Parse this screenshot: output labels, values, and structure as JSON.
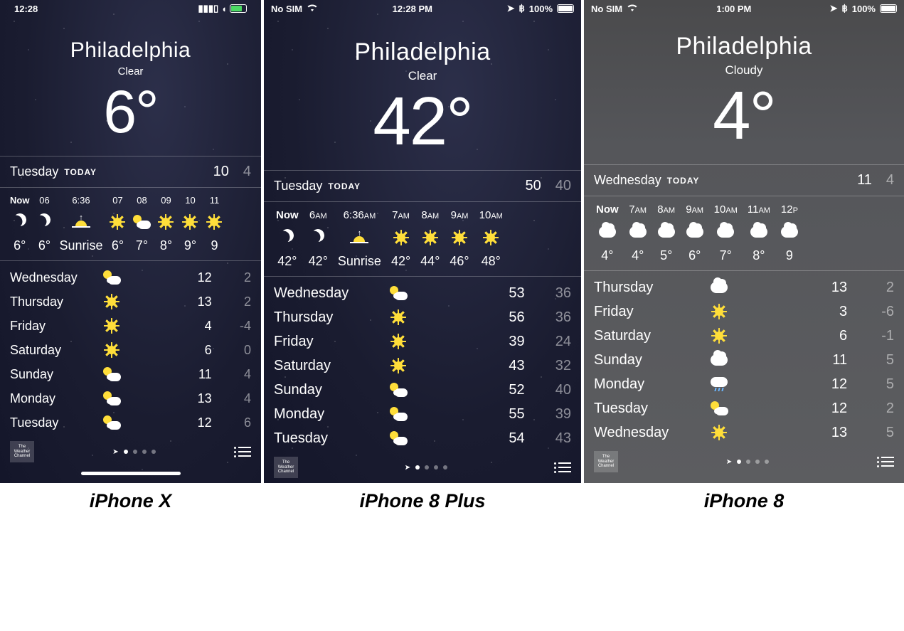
{
  "captions": [
    "iPhone X",
    "iPhone 8 Plus",
    "iPhone 8"
  ],
  "phones": [
    {
      "style": "starry notch",
      "status": {
        "left": "12:28",
        "carrier": "",
        "right_items": [],
        "battery": "",
        "has_wifi": true,
        "has_cell": true,
        "charging": true
      },
      "city": "Philadelphia",
      "condition": "Clear",
      "temp": "6°",
      "today": {
        "day": "Tuesday",
        "label": "TODAY",
        "hi": "10",
        "lo": "4"
      },
      "hours": [
        {
          "t": "Now",
          "icon": "moon",
          "v": "6°",
          "now": true
        },
        {
          "t": "06",
          "icon": "moon",
          "v": "6°"
        },
        {
          "t": "6:36",
          "icon": "sunrise",
          "v": "Sunrise"
        },
        {
          "t": "07",
          "icon": "sun",
          "v": "6°"
        },
        {
          "t": "08",
          "icon": "partly",
          "v": "7°"
        },
        {
          "t": "09",
          "icon": "sun",
          "v": "8°"
        },
        {
          "t": "10",
          "icon": "sun",
          "v": "9°"
        },
        {
          "t": "11",
          "icon": "sun",
          "v": "9"
        }
      ],
      "days": [
        {
          "n": "Wednesday",
          "i": "partly",
          "h": "12",
          "l": "2"
        },
        {
          "n": "Thursday",
          "i": "sun",
          "h": "13",
          "l": "2"
        },
        {
          "n": "Friday",
          "i": "sun",
          "h": "4",
          "l": "-4"
        },
        {
          "n": "Saturday",
          "i": "sun",
          "h": "6",
          "l": "0"
        },
        {
          "n": "Sunday",
          "i": "partly",
          "h": "11",
          "l": "4"
        },
        {
          "n": "Monday",
          "i": "partly",
          "h": "13",
          "l": "4"
        },
        {
          "n": "Tuesday",
          "i": "partly",
          "h": "12",
          "l": "6"
        }
      ],
      "pager_dots": 4,
      "twc": "The\nWeather\nChannel",
      "homebar": true
    },
    {
      "style": "starry",
      "status": {
        "left": "",
        "carrier": "No SIM",
        "time": "12:28 PM",
        "right": "100%",
        "has_wifi": true,
        "has_loc": true,
        "has_bt": true,
        "has_batt": true
      },
      "city": "Philadelphia",
      "condition": "Clear",
      "temp": "42°",
      "today": {
        "day": "Tuesday",
        "label": "TODAY",
        "hi": "50",
        "lo": "40"
      },
      "hours": [
        {
          "t": "Now",
          "icon": "moon",
          "v": "42°",
          "now": true
        },
        {
          "t": "6",
          "ampm": "AM",
          "icon": "moon",
          "v": "42°"
        },
        {
          "t": "6:36",
          "ampm": "AM",
          "icon": "sunrise",
          "v": "Sunrise"
        },
        {
          "t": "7",
          "ampm": "AM",
          "icon": "sun",
          "v": "42°"
        },
        {
          "t": "8",
          "ampm": "AM",
          "icon": "sun",
          "v": "44°"
        },
        {
          "t": "9",
          "ampm": "AM",
          "icon": "sun",
          "v": "46°"
        },
        {
          "t": "10",
          "ampm": "AM",
          "icon": "sun",
          "v": "48°"
        }
      ],
      "days": [
        {
          "n": "Wednesday",
          "i": "partly",
          "h": "53",
          "l": "36"
        },
        {
          "n": "Thursday",
          "i": "sun",
          "h": "56",
          "l": "36"
        },
        {
          "n": "Friday",
          "i": "sun",
          "h": "39",
          "l": "24"
        },
        {
          "n": "Saturday",
          "i": "sun",
          "h": "43",
          "l": "32"
        },
        {
          "n": "Sunday",
          "i": "partly",
          "h": "52",
          "l": "40"
        },
        {
          "n": "Monday",
          "i": "partly",
          "h": "55",
          "l": "39"
        },
        {
          "n": "Tuesday",
          "i": "partly",
          "h": "54",
          "l": "43"
        }
      ],
      "pager_dots": 4,
      "twc": "The\nWeather\nChannel"
    },
    {
      "style": "cloudy",
      "status": {
        "left": "",
        "carrier": "No SIM",
        "time": "1:00 PM",
        "right": "100%",
        "has_wifi": true,
        "has_loc": true,
        "has_bt": true,
        "has_batt": true
      },
      "city": "Philadelphia",
      "condition": "Cloudy",
      "temp": "4°",
      "today": {
        "day": "Wednesday",
        "label": "TODAY",
        "hi": "11",
        "lo": "4"
      },
      "hours": [
        {
          "t": "Now",
          "icon": "cloud",
          "v": "4°",
          "now": true
        },
        {
          "t": "7",
          "ampm": "AM",
          "icon": "cloud",
          "v": "4°"
        },
        {
          "t": "8",
          "ampm": "AM",
          "icon": "cloud",
          "v": "5°"
        },
        {
          "t": "9",
          "ampm": "AM",
          "icon": "cloud",
          "v": "6°"
        },
        {
          "t": "10",
          "ampm": "AM",
          "icon": "cloud",
          "v": "7°"
        },
        {
          "t": "11",
          "ampm": "AM",
          "icon": "cloud",
          "v": "8°"
        },
        {
          "t": "12",
          "ampm": "P",
          "icon": "cloud",
          "v": "9"
        }
      ],
      "days": [
        {
          "n": "Thursday",
          "i": "cloud",
          "h": "13",
          "l": "2"
        },
        {
          "n": "Friday",
          "i": "sun",
          "h": "3",
          "l": "-6"
        },
        {
          "n": "Saturday",
          "i": "sun",
          "h": "6",
          "l": "-1"
        },
        {
          "n": "Sunday",
          "i": "cloud",
          "h": "11",
          "l": "5"
        },
        {
          "n": "Monday",
          "i": "rain",
          "h": "12",
          "l": "5"
        },
        {
          "n": "Tuesday",
          "i": "partly",
          "h": "12",
          "l": "2"
        },
        {
          "n": "Wednesday",
          "i": "sun",
          "h": "13",
          "l": "5"
        }
      ],
      "pager_dots": 4,
      "twc": "The\nWeather\nChannel"
    }
  ]
}
